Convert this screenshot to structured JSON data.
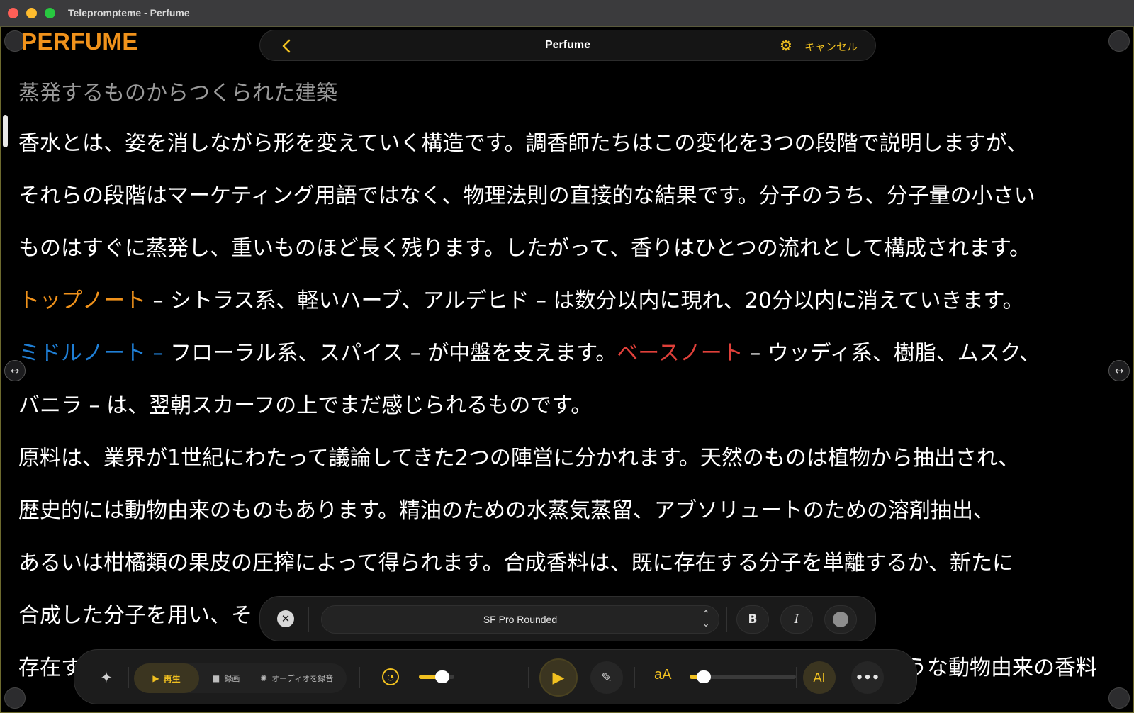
{
  "window": {
    "title": "Teleprompteme - Perfume"
  },
  "logo": {
    "text": "PERFUME"
  },
  "nav": {
    "back_icon": "chevron-left-icon",
    "title": "Perfume",
    "gear_icon": "gear-icon",
    "cancel_label": "キャンセル"
  },
  "script": {
    "heading": "蒸発するものからつくられた建築",
    "line1": "香水とは、姿を消しながら形を変えていく構造です。調香師たちはこの変化を3つの段階で説明しますが、",
    "line2": "それらの段階はマーケティング用語ではなく、物理法則の直接的な結果です。分子のうち、分子量の小さい",
    "line3": "ものはすぐに蒸発し、重いものほど長く残ります。したがって、香りはひとつの流れとして構成されます。",
    "top_note": "トップノート",
    "top_note_rest": " – シトラス系、軽いハーブ、アルデヒド – は数分以内に現れ、20分以内に消えていきます。",
    "middle_note": "ミドルノート –",
    "middle_note_rest": " フローラル系、スパイス – が中盤を支えます。",
    "base_note": "ベースノート",
    "base_note_rest": " – ウッディ系、樹脂、ムスク、",
    "line6": "バニラ – は、翌朝スカーフの上でまだ感じられるものです。",
    "line7": "原料は、業界が1世紀にわたって議論してきた2つの陣営に分かれます。天然のものは植物から抽出され、",
    "line8": "歴史的には動物由来のものもあります。精油のための水蒸気蒸留、アブソリュートのための溶剤抽出、",
    "line9": "あるいは柑橘類の果皮の圧搾によって得られます。合成香料は、既に存在する分子を単離するか、新たに",
    "line10": "合成した分子を用い、そ",
    "line11_start": "存在す",
    "line11_end": "ような動物由来の香料"
  },
  "format_bar": {
    "close_icon": "close-icon",
    "font_name": "SF Pro Rounded",
    "bold_label": "B",
    "italic_label": "I",
    "text_color": "#8e8e8e"
  },
  "controls": {
    "play_tab": "再生",
    "record_tab": "録画",
    "audio_tab": "オーディオを録音",
    "font_size_label": "aA",
    "ai_label": "AI",
    "speed_level": 0.75,
    "font_size_level": 0.08,
    "accent_color": "#f0c020"
  }
}
